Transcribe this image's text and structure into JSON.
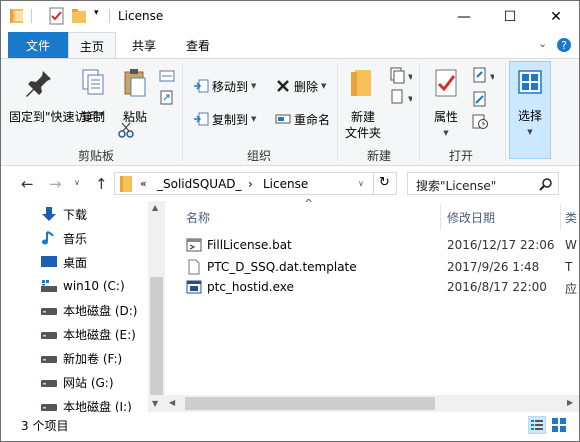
{
  "window": {
    "title": "License",
    "controls": {
      "minimize": "—",
      "maximize": "☐",
      "close": "✕"
    }
  },
  "ribbon_tabs": [
    {
      "label": "文件"
    },
    {
      "label": "主页"
    },
    {
      "label": "共享"
    },
    {
      "label": "查看"
    }
  ],
  "ribbon": {
    "clipboard": {
      "label": "剪贴板",
      "pin": "固定到\"快速访问\"",
      "copy": "复制",
      "paste": "粘贴"
    },
    "organize": {
      "label": "组织",
      "move_to": "移动到",
      "copy_to": "复制到",
      "delete": "删除",
      "rename": "重命名"
    },
    "new": {
      "label": "新建",
      "new_folder": "新建\n文件夹"
    },
    "open": {
      "label": "打开",
      "properties": "属性"
    },
    "select": {
      "label": "选择"
    }
  },
  "address": {
    "path": [
      "«",
      "_SolidSQUAD_",
      "›",
      "License"
    ],
    "search_placeholder": "搜索\"License\""
  },
  "nav_items": [
    {
      "label": "下载",
      "icon": "download-icon"
    },
    {
      "label": "音乐",
      "icon": "music-icon"
    },
    {
      "label": "桌面",
      "icon": "desktop-icon"
    },
    {
      "label": "win10 (C:)",
      "icon": "drive-icon"
    },
    {
      "label": "本地磁盘 (D:)",
      "icon": "drive-icon"
    },
    {
      "label": "本地磁盘 (E:)",
      "icon": "drive-icon"
    },
    {
      "label": "新加卷 (F:)",
      "icon": "drive-icon"
    },
    {
      "label": "网站 (G:)",
      "icon": "drive-icon"
    },
    {
      "label": "本地磁盘 (I:)",
      "icon": "drive-icon"
    }
  ],
  "columns": {
    "name": "名称",
    "date": "修改日期",
    "type": "类"
  },
  "files": [
    {
      "name": "FillLicense.bat",
      "date": "2016/12/17 22:06",
      "type": "W",
      "icon": "batch-file-icon"
    },
    {
      "name": "PTC_D_SSQ.dat.template",
      "date": "2017/9/26 1:48",
      "type": "T",
      "icon": "document-icon"
    },
    {
      "name": "ptc_hostid.exe",
      "date": "2016/8/17 22:00",
      "type": "应",
      "icon": "exe-icon"
    }
  ],
  "status": {
    "count": "3 个项目"
  },
  "colors": {
    "accent": "#1979ca",
    "ribbon_bg": "#f5f6f7",
    "select_bg": "#cce8ff"
  }
}
